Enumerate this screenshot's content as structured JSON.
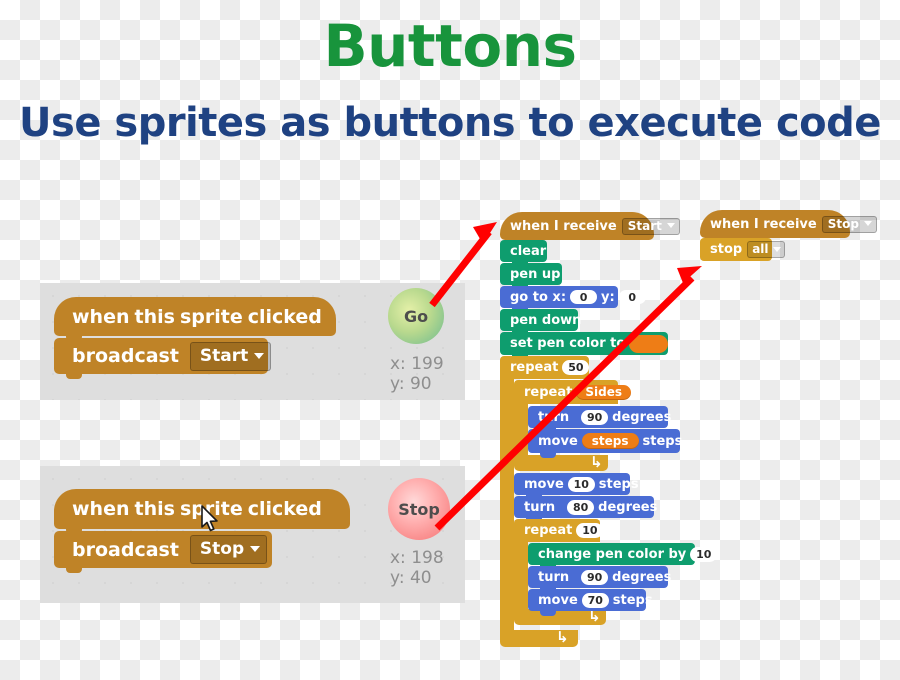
{
  "slide": {
    "title": "Buttons",
    "subtitle": "Use sprites as buttons to execute code",
    "title_color": "#18943C",
    "subtitle_color": "#1F4282",
    "arrow_color": "#FF0000"
  },
  "palette": {
    "event": "#BF8327",
    "control": "#D9A227",
    "pen": "#0E9D6E",
    "motion": "#4A6CD4",
    "variable": "#EE7D16",
    "panel_bg": "#DEDEDE"
  },
  "sprites": [
    {
      "name": "Go",
      "label": "Go",
      "x_label": "x: 199",
      "y_label": "y: 90",
      "color": "#8FC88F",
      "script": {
        "hat": {
          "words": [
            "when",
            "this",
            "sprite",
            "clicked"
          ]
        },
        "broadcast": {
          "label": "broadcast",
          "value": "Start"
        }
      }
    },
    {
      "name": "Stop",
      "label": "Stop",
      "x_label": "x: 198",
      "y_label": "y: 40",
      "color": "#F98B8B",
      "script": {
        "hat": {
          "words": [
            "when",
            "this",
            "sprite",
            "clicked"
          ]
        },
        "broadcast": {
          "label": "broadcast",
          "value": "Stop"
        }
      }
    }
  ],
  "main_script": {
    "hat": {
      "prefix": "when I receive",
      "value": "Start"
    },
    "blocks": {
      "clear": "clear",
      "pen_up": "pen up",
      "go_to": {
        "prefix": "go to x:",
        "x": "0",
        "mid": "y:",
        "y": "0"
      },
      "pen_down": "pen down",
      "set_pen_color": "set pen color to",
      "repeat_outer": {
        "label": "repeat",
        "value": "50"
      },
      "repeat_inner": {
        "label": "repeat",
        "value": "Sides"
      },
      "turn_90_a": {
        "prefix": "turn",
        "value": "90",
        "suffix": "degrees"
      },
      "move_steps_var": {
        "prefix": "move",
        "value": "steps",
        "suffix": "steps"
      },
      "move_10": {
        "prefix": "move",
        "value": "10",
        "suffix": "steps"
      },
      "turn_80": {
        "prefix": "turn",
        "value": "80",
        "suffix": "degrees"
      },
      "repeat_10": {
        "label": "repeat",
        "value": "10"
      },
      "change_pen_color": {
        "prefix": "change pen color by",
        "value": "10"
      },
      "turn_90_b": {
        "prefix": "turn",
        "value": "90",
        "suffix": "degrees"
      },
      "move_70": {
        "prefix": "move",
        "value": "70",
        "suffix": "steps"
      }
    }
  },
  "stop_script": {
    "hat": {
      "prefix": "when I receive",
      "value": "Stop"
    },
    "stop": {
      "label": "stop",
      "value": "all"
    }
  },
  "icons": {
    "dropdown": "chevron-down-icon",
    "turn_right": "turn-clockwise-icon",
    "loop": "loop-arrow-icon",
    "cursor": "mouse-pointer-icon"
  }
}
